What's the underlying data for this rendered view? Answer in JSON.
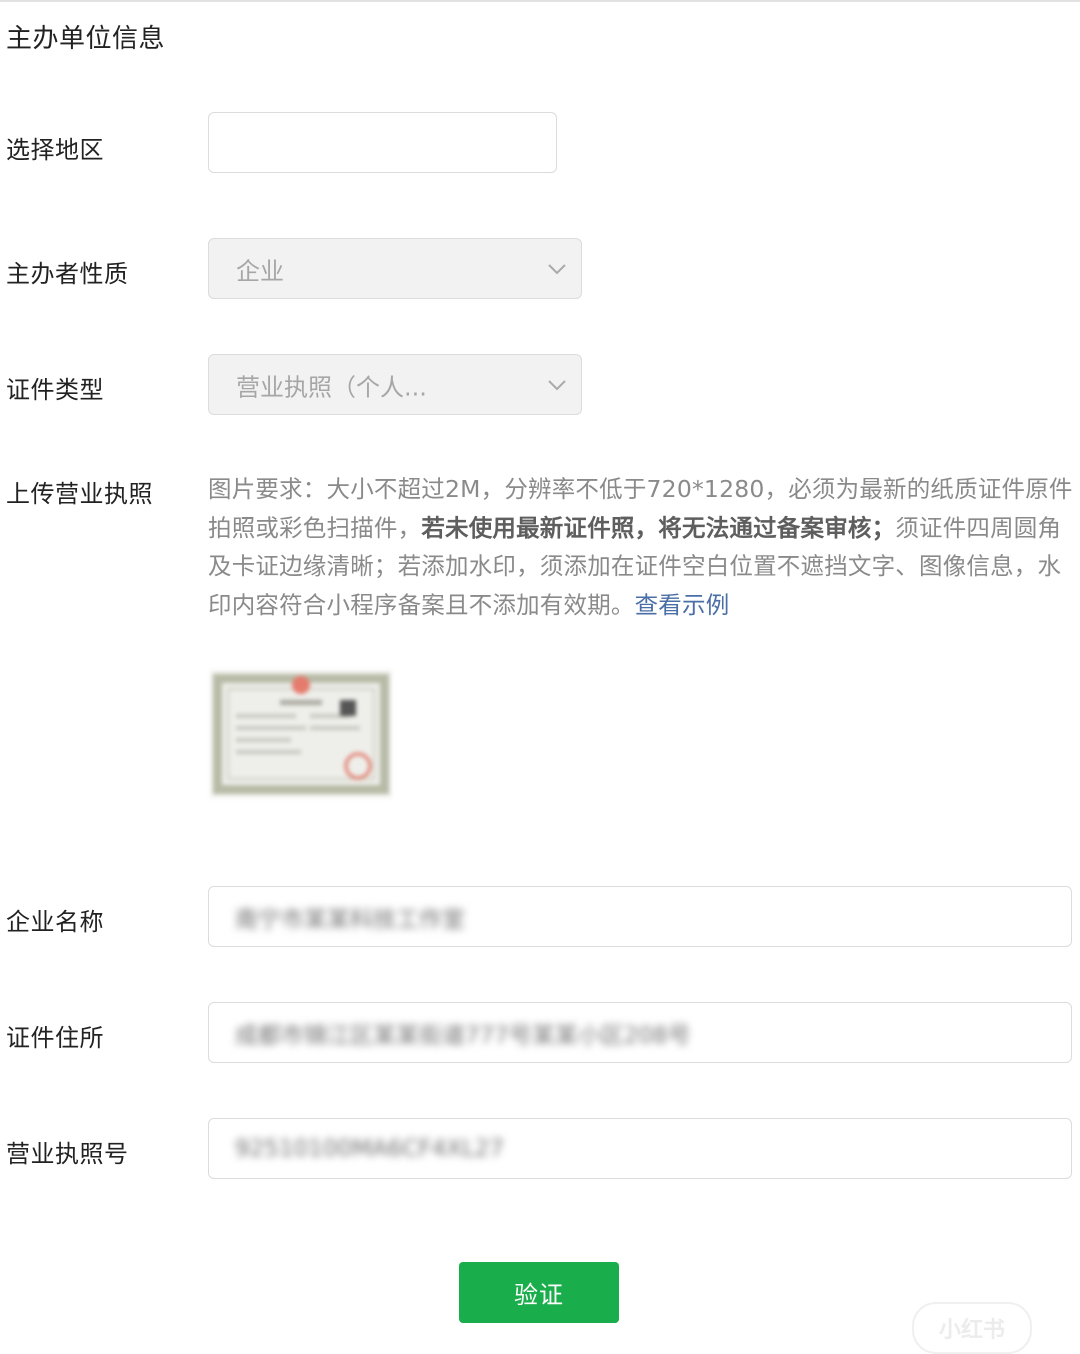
{
  "section": {
    "title": "主办单位信息"
  },
  "fields": {
    "region": {
      "label": "选择地区",
      "value": ""
    },
    "nature": {
      "label": "主办者性质",
      "value": "企业"
    },
    "cert_type": {
      "label": "证件类型",
      "value": "营业执照（个人..."
    },
    "upload": {
      "label": "上传营业执照",
      "req_1": "图片要求：大小不超过2M，分辨率不低于720*1280，必须为最新的纸质证件原件拍照或彩色扫描件，",
      "req_bold": "若未使用最新证件照，将无法通过备案审核；",
      "req_2": "须证件四周圆角及卡证边缘清晰；若添加水印，须添加在证件空白位置不遮挡文字、图像信息，水印内容符合小程序备案且不添加有效期。",
      "example_link": "查看示例"
    },
    "company_name": {
      "label": "企业名称",
      "value": "南宁市某某科技工作室"
    },
    "address": {
      "label": "证件住所",
      "value": "成都市锦江区某某街道777号某某小区208号"
    },
    "license_no": {
      "label": "营业执照号",
      "value": "92510100MA6CF4XL27"
    }
  },
  "verify_button": "验证",
  "watermark": "小红书",
  "colors": {
    "primary": "#1aad4b",
    "link": "#4a6ea6"
  }
}
